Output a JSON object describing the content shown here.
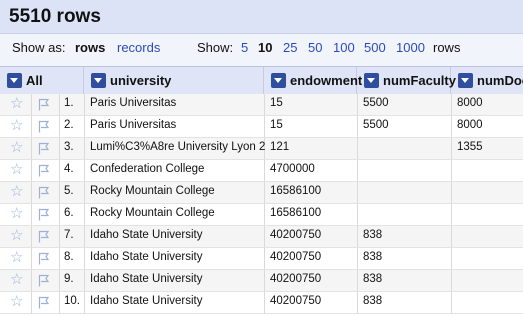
{
  "header": {
    "title": "5510 rows"
  },
  "controls": {
    "show_as_label": "Show as:",
    "modes": [
      "rows",
      "records"
    ],
    "active_mode": "rows",
    "show_label": "Show:",
    "page_sizes": [
      "5",
      "10",
      "25",
      "50",
      "100",
      "500",
      "1000"
    ],
    "active_page_size": "10",
    "rows_suffix": "rows"
  },
  "columns": {
    "all": "All",
    "university": "university",
    "endowment": "endowment",
    "numFaculty": "numFaculty",
    "numDoctoral": "numDoct"
  },
  "rows": [
    {
      "num": "1.",
      "university": "Paris Universitas",
      "endowment": "15",
      "numFaculty": "5500",
      "numDoctoral": "8000"
    },
    {
      "num": "2.",
      "university": "Paris Universitas",
      "endowment": "15",
      "numFaculty": "5500",
      "numDoctoral": "8000"
    },
    {
      "num": "3.",
      "university": "Lumi%C3%A8re University Lyon 2",
      "endowment": "121",
      "numFaculty": "",
      "numDoctoral": "1355"
    },
    {
      "num": "4.",
      "university": "Confederation College",
      "endowment": "4700000",
      "numFaculty": "",
      "numDoctoral": ""
    },
    {
      "num": "5.",
      "university": "Rocky Mountain College",
      "endowment": "16586100",
      "numFaculty": "",
      "numDoctoral": ""
    },
    {
      "num": "6.",
      "university": "Rocky Mountain College",
      "endowment": "16586100",
      "numFaculty": "",
      "numDoctoral": ""
    },
    {
      "num": "7.",
      "university": "Idaho State University",
      "endowment": "40200750",
      "numFaculty": "838",
      "numDoctoral": ""
    },
    {
      "num": "8.",
      "university": "Idaho State University",
      "endowment": "40200750",
      "numFaculty": "838",
      "numDoctoral": ""
    },
    {
      "num": "9.",
      "university": "Idaho State University",
      "endowment": "40200750",
      "numFaculty": "838",
      "numDoctoral": ""
    },
    {
      "num": "10.",
      "university": "Idaho State University",
      "endowment": "40200750",
      "numFaculty": "838",
      "numDoctoral": ""
    }
  ],
  "icons": {
    "star": "star-icon",
    "flag": "flag-icon",
    "dropdown": "dropdown-arrow-icon"
  },
  "colors": {
    "header_bg": "#dce3f7",
    "link": "#2a4bbf",
    "dropdown_bg": "#2f4f9e"
  }
}
